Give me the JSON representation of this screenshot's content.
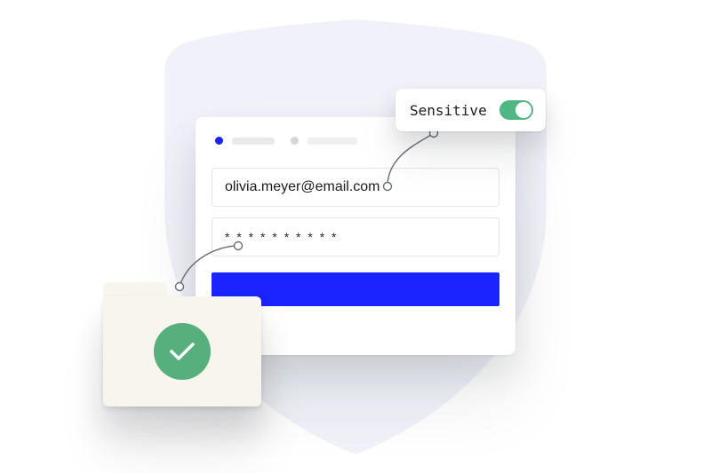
{
  "badge": {
    "label": "Sensitive",
    "toggle_on": true
  },
  "form": {
    "email": "olivia.meyer@email.com",
    "password_mask": "* * * * * * * * * *"
  },
  "colors": {
    "accent_blue": "#1a24ff",
    "toggle_green": "#4eb784",
    "check_green": "#56af7c",
    "shield_bg": "#f1f2f9",
    "folder_bg": "#f8f5ee"
  },
  "icons": {
    "shield": "shield-icon",
    "check": "check-circle-icon",
    "folder": "secure-folder-icon",
    "toggle": "toggle-on-icon"
  }
}
